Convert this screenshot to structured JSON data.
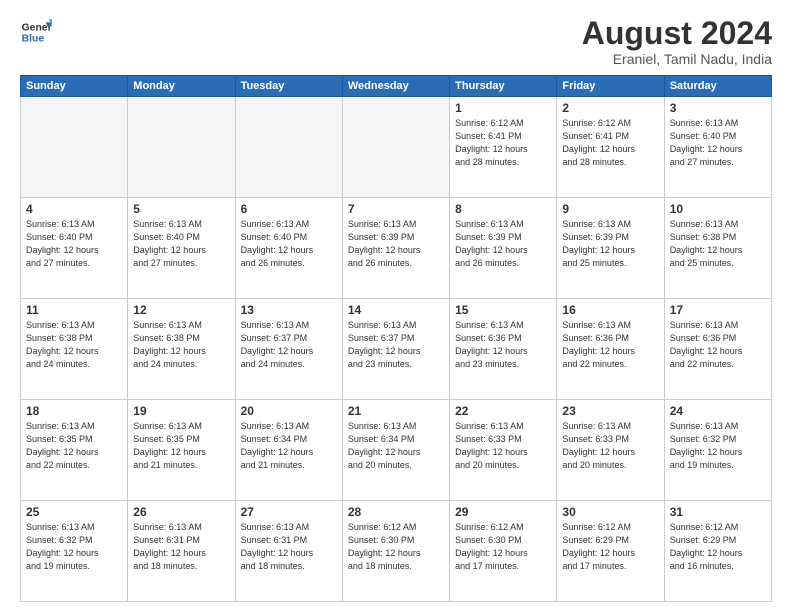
{
  "logo": {
    "line1": "General",
    "line2": "Blue"
  },
  "title": "August 2024",
  "subtitle": "Eraniel, Tamil Nadu, India",
  "days_header": [
    "Sunday",
    "Monday",
    "Tuesday",
    "Wednesday",
    "Thursday",
    "Friday",
    "Saturday"
  ],
  "weeks": [
    [
      {
        "day": "",
        "detail": ""
      },
      {
        "day": "",
        "detail": ""
      },
      {
        "day": "",
        "detail": ""
      },
      {
        "day": "",
        "detail": ""
      },
      {
        "day": "1",
        "detail": "Sunrise: 6:12 AM\nSunset: 6:41 PM\nDaylight: 12 hours\nand 28 minutes."
      },
      {
        "day": "2",
        "detail": "Sunrise: 6:12 AM\nSunset: 6:41 PM\nDaylight: 12 hours\nand 28 minutes."
      },
      {
        "day": "3",
        "detail": "Sunrise: 6:13 AM\nSunset: 6:40 PM\nDaylight: 12 hours\nand 27 minutes."
      }
    ],
    [
      {
        "day": "4",
        "detail": "Sunrise: 6:13 AM\nSunset: 6:40 PM\nDaylight: 12 hours\nand 27 minutes."
      },
      {
        "day": "5",
        "detail": "Sunrise: 6:13 AM\nSunset: 6:40 PM\nDaylight: 12 hours\nand 27 minutes."
      },
      {
        "day": "6",
        "detail": "Sunrise: 6:13 AM\nSunset: 6:40 PM\nDaylight: 12 hours\nand 26 minutes."
      },
      {
        "day": "7",
        "detail": "Sunrise: 6:13 AM\nSunset: 6:39 PM\nDaylight: 12 hours\nand 26 minutes."
      },
      {
        "day": "8",
        "detail": "Sunrise: 6:13 AM\nSunset: 6:39 PM\nDaylight: 12 hours\nand 26 minutes."
      },
      {
        "day": "9",
        "detail": "Sunrise: 6:13 AM\nSunset: 6:39 PM\nDaylight: 12 hours\nand 25 minutes."
      },
      {
        "day": "10",
        "detail": "Sunrise: 6:13 AM\nSunset: 6:38 PM\nDaylight: 12 hours\nand 25 minutes."
      }
    ],
    [
      {
        "day": "11",
        "detail": "Sunrise: 6:13 AM\nSunset: 6:38 PM\nDaylight: 12 hours\nand 24 minutes."
      },
      {
        "day": "12",
        "detail": "Sunrise: 6:13 AM\nSunset: 6:38 PM\nDaylight: 12 hours\nand 24 minutes."
      },
      {
        "day": "13",
        "detail": "Sunrise: 6:13 AM\nSunset: 6:37 PM\nDaylight: 12 hours\nand 24 minutes."
      },
      {
        "day": "14",
        "detail": "Sunrise: 6:13 AM\nSunset: 6:37 PM\nDaylight: 12 hours\nand 23 minutes."
      },
      {
        "day": "15",
        "detail": "Sunrise: 6:13 AM\nSunset: 6:36 PM\nDaylight: 12 hours\nand 23 minutes."
      },
      {
        "day": "16",
        "detail": "Sunrise: 6:13 AM\nSunset: 6:36 PM\nDaylight: 12 hours\nand 22 minutes."
      },
      {
        "day": "17",
        "detail": "Sunrise: 6:13 AM\nSunset: 6:36 PM\nDaylight: 12 hours\nand 22 minutes."
      }
    ],
    [
      {
        "day": "18",
        "detail": "Sunrise: 6:13 AM\nSunset: 6:35 PM\nDaylight: 12 hours\nand 22 minutes."
      },
      {
        "day": "19",
        "detail": "Sunrise: 6:13 AM\nSunset: 6:35 PM\nDaylight: 12 hours\nand 21 minutes."
      },
      {
        "day": "20",
        "detail": "Sunrise: 6:13 AM\nSunset: 6:34 PM\nDaylight: 12 hours\nand 21 minutes."
      },
      {
        "day": "21",
        "detail": "Sunrise: 6:13 AM\nSunset: 6:34 PM\nDaylight: 12 hours\nand 20 minutes."
      },
      {
        "day": "22",
        "detail": "Sunrise: 6:13 AM\nSunset: 6:33 PM\nDaylight: 12 hours\nand 20 minutes."
      },
      {
        "day": "23",
        "detail": "Sunrise: 6:13 AM\nSunset: 6:33 PM\nDaylight: 12 hours\nand 20 minutes."
      },
      {
        "day": "24",
        "detail": "Sunrise: 6:13 AM\nSunset: 6:32 PM\nDaylight: 12 hours\nand 19 minutes."
      }
    ],
    [
      {
        "day": "25",
        "detail": "Sunrise: 6:13 AM\nSunset: 6:32 PM\nDaylight: 12 hours\nand 19 minutes."
      },
      {
        "day": "26",
        "detail": "Sunrise: 6:13 AM\nSunset: 6:31 PM\nDaylight: 12 hours\nand 18 minutes."
      },
      {
        "day": "27",
        "detail": "Sunrise: 6:13 AM\nSunset: 6:31 PM\nDaylight: 12 hours\nand 18 minutes."
      },
      {
        "day": "28",
        "detail": "Sunrise: 6:12 AM\nSunset: 6:30 PM\nDaylight: 12 hours\nand 18 minutes."
      },
      {
        "day": "29",
        "detail": "Sunrise: 6:12 AM\nSunset: 6:30 PM\nDaylight: 12 hours\nand 17 minutes."
      },
      {
        "day": "30",
        "detail": "Sunrise: 6:12 AM\nSunset: 6:29 PM\nDaylight: 12 hours\nand 17 minutes."
      },
      {
        "day": "31",
        "detail": "Sunrise: 6:12 AM\nSunset: 6:29 PM\nDaylight: 12 hours\nand 16 minutes."
      }
    ]
  ]
}
